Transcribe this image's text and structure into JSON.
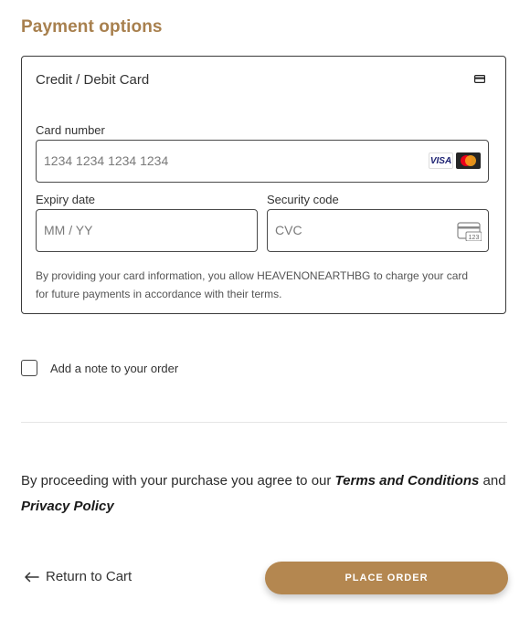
{
  "page": {
    "title": "Payment options"
  },
  "payment": {
    "method_label": "Credit / Debit Card",
    "method_icon": "credit-card-icon",
    "card_number": {
      "label": "Card number",
      "placeholder": "1234 1234 1234 1234",
      "brands": [
        "VISA",
        "mastercard"
      ]
    },
    "expiry": {
      "label": "Expiry date",
      "placeholder": "MM / YY"
    },
    "security": {
      "label": "Security code",
      "placeholder": "CVC",
      "icon_text": "123"
    },
    "consent": "By providing your card information, you allow HEAVENONEARTHBG to charge your card for future payments in accordance with their terms."
  },
  "note": {
    "label": "Add a note to your order",
    "checked": false
  },
  "terms": {
    "prefix": "By proceeding with your purchase you agree to our ",
    "terms_link": "Terms and Conditions",
    "middle": " and ",
    "privacy_link": "Privacy Policy"
  },
  "actions": {
    "return_label": "Return to Cart",
    "place_order_label": "PLACE ORDER"
  },
  "colors": {
    "accent": "#a8804e",
    "button": "#b48750"
  }
}
